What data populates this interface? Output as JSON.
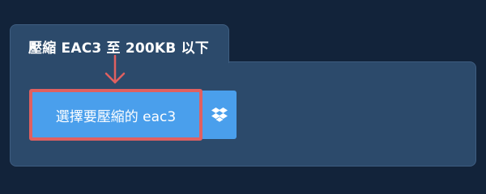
{
  "tab": {
    "title": "壓縮 EAC3 至 200KB 以下"
  },
  "upload": {
    "choose_label": "選擇要壓縮的 eac3",
    "dropbox_icon": "dropbox-icon"
  },
  "colors": {
    "background": "#12233a",
    "panel": "#2c4a6b",
    "button": "#4a9fec",
    "highlight": "#e06060"
  }
}
